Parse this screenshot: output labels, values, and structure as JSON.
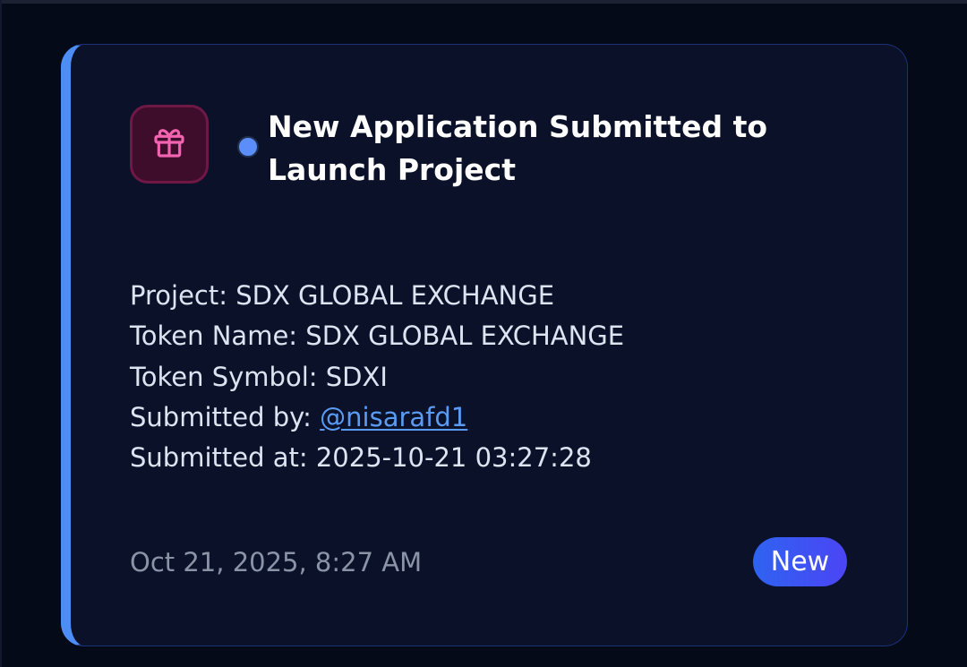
{
  "notification": {
    "title": "New Application Submitted to Launch Project",
    "icon": "gift-icon",
    "unread": true,
    "details": {
      "project_label": "Project:",
      "project_value": "SDX GLOBAL EXCHANGE",
      "token_name_label": "Token Name:",
      "token_name_value": "SDX GLOBAL EXCHANGE",
      "token_symbol_label": "Token Symbol:",
      "token_symbol_value": "SDXI",
      "submitted_by_label": "Submitted by:",
      "submitted_by_value": "@nisarafd1",
      "submitted_at_label": "Submitted at:",
      "submitted_at_value": "2025-10-21 03:27:28"
    },
    "timestamp": "Oct 21, 2025, 8:27 AM",
    "badge": "New"
  },
  "colors": {
    "background": "#050a19",
    "card": "#0a1128",
    "accent": "#4c8ef6",
    "icon_pink": "#f263b0",
    "unread_dot": "#5b8ef8",
    "link": "#5b9bf3",
    "badge": "#3a55f2"
  }
}
